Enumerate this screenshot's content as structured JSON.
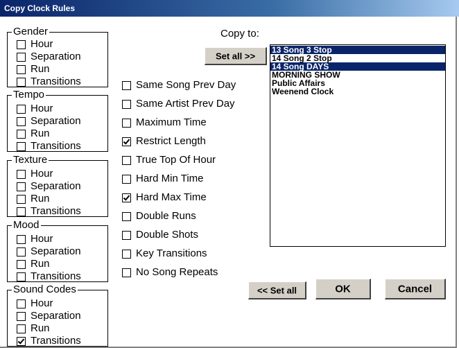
{
  "window": {
    "title": "Copy Clock Rules"
  },
  "groups": [
    {
      "legend": "Gender",
      "items": [
        {
          "label": "Hour",
          "checked": false
        },
        {
          "label": "Separation",
          "checked": false
        },
        {
          "label": "Run",
          "checked": false
        },
        {
          "label": "Transitions",
          "checked": false
        }
      ]
    },
    {
      "legend": "Tempo",
      "items": [
        {
          "label": "Hour",
          "checked": false
        },
        {
          "label": "Separation",
          "checked": false
        },
        {
          "label": "Run",
          "checked": false
        },
        {
          "label": "Transitions",
          "checked": false
        }
      ]
    },
    {
      "legend": "Texture",
      "items": [
        {
          "label": "Hour",
          "checked": false
        },
        {
          "label": "Separation",
          "checked": false
        },
        {
          "label": "Run",
          "checked": false
        },
        {
          "label": "Transitions",
          "checked": false
        }
      ]
    },
    {
      "legend": "Mood",
      "items": [
        {
          "label": "Hour",
          "checked": false
        },
        {
          "label": "Separation",
          "checked": false
        },
        {
          "label": "Run",
          "checked": false
        },
        {
          "label": "Transitions",
          "checked": false
        }
      ]
    },
    {
      "legend": "Sound Codes",
      "items": [
        {
          "label": "Hour",
          "checked": false
        },
        {
          "label": "Separation",
          "checked": false
        },
        {
          "label": "Run",
          "checked": false
        },
        {
          "label": "Transitions",
          "checked": true
        }
      ]
    }
  ],
  "rules": [
    {
      "label": "Same Song Prev Day",
      "checked": false
    },
    {
      "label": "Same Artist Prev Day",
      "checked": false
    },
    {
      "label": "Maximum Time",
      "checked": false
    },
    {
      "label": "Restrict Length",
      "checked": true
    },
    {
      "label": "True Top Of Hour",
      "checked": false
    },
    {
      "label": "Hard Min Time",
      "checked": false
    },
    {
      "label": "Hard Max Time",
      "checked": true
    },
    {
      "label": "Double Runs",
      "checked": false
    },
    {
      "label": "Double Shots",
      "checked": false
    },
    {
      "label": "Key Transitions",
      "checked": false
    },
    {
      "label": "No Song Repeats",
      "checked": false
    }
  ],
  "copy_to": {
    "label": "Copy to:",
    "items": [
      {
        "label": "13 Song 3 Stop",
        "selected": true
      },
      {
        "label": "14 Song 2 Stop",
        "selected": false
      },
      {
        "label": "14 Song DAYS",
        "selected": true
      },
      {
        "label": "MORNING SHOW",
        "selected": false
      },
      {
        "label": "Public Affairs",
        "selected": false
      },
      {
        "label": "Weenend Clock",
        "selected": false
      }
    ]
  },
  "buttons": {
    "set_all_right": "Set all >>",
    "set_all_left": "<< Set all",
    "ok": "OK",
    "cancel": "Cancel"
  }
}
